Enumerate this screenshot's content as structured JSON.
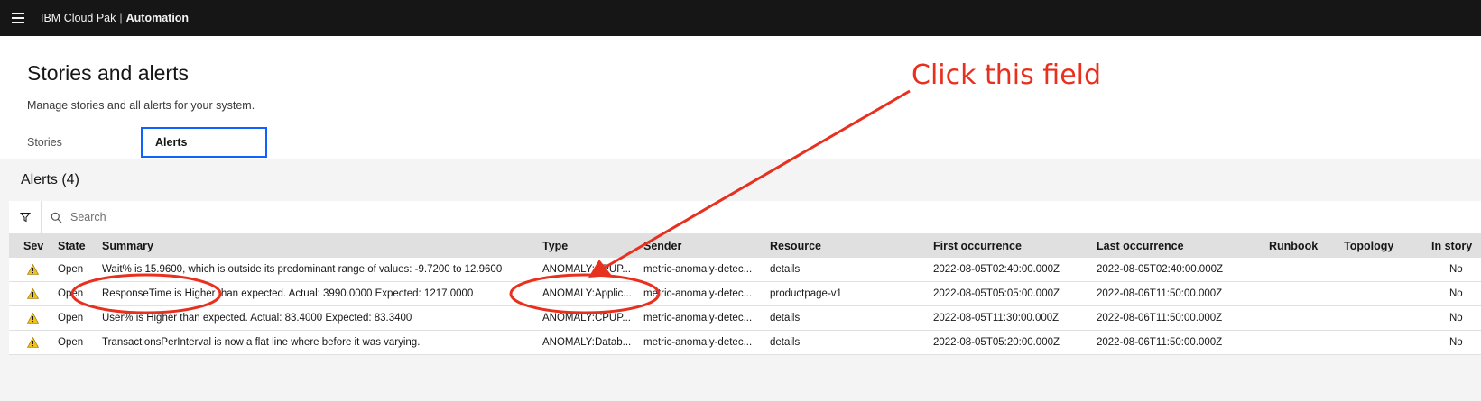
{
  "app": {
    "brand": "IBM Cloud Pak",
    "separator": "|",
    "product": "Automation"
  },
  "page": {
    "title": "Stories and alerts",
    "description": "Manage stories and all alerts for your system."
  },
  "tabs": [
    {
      "label": "Stories",
      "selected": false
    },
    {
      "label": "Alerts",
      "selected": true
    }
  ],
  "alerts_section": {
    "title": "Alerts (4)"
  },
  "toolbar": {
    "icons": [
      "filter-icon",
      "search-icon"
    ],
    "search_placeholder": "Search"
  },
  "table": {
    "columns": [
      "Sev",
      "State",
      "Summary",
      "Type",
      "Sender",
      "Resource",
      "First occurrence",
      "Last occurrence",
      "Runbook",
      "Topology",
      "In story"
    ],
    "rows": [
      {
        "sev_icon": "warning-icon",
        "state": "Open",
        "summary": "Wait% is 15.9600, which is outside its predominant range of values: -9.7200 to 12.9600",
        "type": "ANOMALY:CPUP...",
        "sender": "metric-anomaly-detec...",
        "resource": "details",
        "first": "2022-08-05T02:40:00.000Z",
        "last": "2022-08-05T02:40:00.000Z",
        "runbook": "",
        "topology": "",
        "in_story": "No"
      },
      {
        "sev_icon": "warning-icon",
        "state": "Open",
        "summary": "ResponseTime is Higher than expected. Actual: 3990.0000 Expected: 1217.0000",
        "type": "ANOMALY:Applic...",
        "sender": "metric-anomaly-detec...",
        "resource": "productpage-v1",
        "first": "2022-08-05T05:05:00.000Z",
        "last": "2022-08-06T11:50:00.000Z",
        "runbook": "",
        "topology": "",
        "in_story": "No"
      },
      {
        "sev_icon": "warning-icon",
        "state": "Open",
        "summary": "User% is Higher than expected. Actual: 83.4000 Expected: 83.3400",
        "type": "ANOMALY:CPUP...",
        "sender": "metric-anomaly-detec...",
        "resource": "details",
        "first": "2022-08-05T11:30:00.000Z",
        "last": "2022-08-06T11:50:00.000Z",
        "runbook": "",
        "topology": "",
        "in_story": "No"
      },
      {
        "sev_icon": "warning-icon",
        "state": "Open",
        "summary": "TransactionsPerInterval is now a flat line where before it was varying.",
        "type": "ANOMALY:Datab...",
        "sender": "metric-anomaly-detec...",
        "resource": "details",
        "first": "2022-08-05T05:20:00.000Z",
        "last": "2022-08-06T11:50:00.000Z",
        "runbook": "",
        "topology": "",
        "in_story": "No"
      }
    ]
  },
  "annotation": {
    "text": "Click this field",
    "color": "#e8301f"
  },
  "colors": {
    "topbar": "#161616",
    "accent": "#0f62fe",
    "warning": "#f1c21b"
  }
}
